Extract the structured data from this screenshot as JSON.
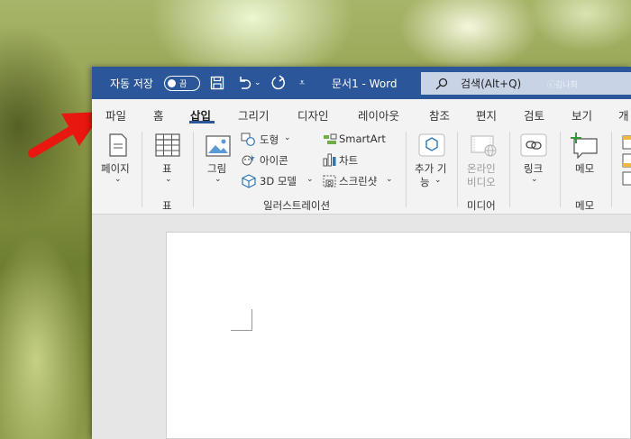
{
  "titlebar": {
    "autosave_label": "자동 저장",
    "autosave_state": "끔",
    "document_title": "문서1  -  Word",
    "search_label": "검색(Alt+Q)",
    "watermark": "ⓒ김나희",
    "bg_color": "#2b579a"
  },
  "tabs": [
    "파일",
    "홈",
    "삽입",
    "그리기",
    "디자인",
    "레이아웃",
    "참조",
    "편지",
    "검토",
    "보기",
    "개"
  ],
  "active_tab": "삽입",
  "ribbon": {
    "pages": {
      "label": "페이지"
    },
    "table": {
      "label": "표",
      "group": "표"
    },
    "illustrations": {
      "picture": "그림",
      "shapes": "도형",
      "icons": "아이콘",
      "models": "3D 모델",
      "smartart": "SmartArt",
      "chart": "차트",
      "screenshot": "스크린샷",
      "group": "일러스트레이션"
    },
    "addins": {
      "label_line1": "추가 기",
      "label_line2": "능"
    },
    "media": {
      "label_line1": "온라인",
      "label_line2": "비디오",
      "group": "미디어"
    },
    "link": {
      "label": "링크"
    },
    "comment": {
      "label": "메모",
      "group": "메모"
    }
  }
}
